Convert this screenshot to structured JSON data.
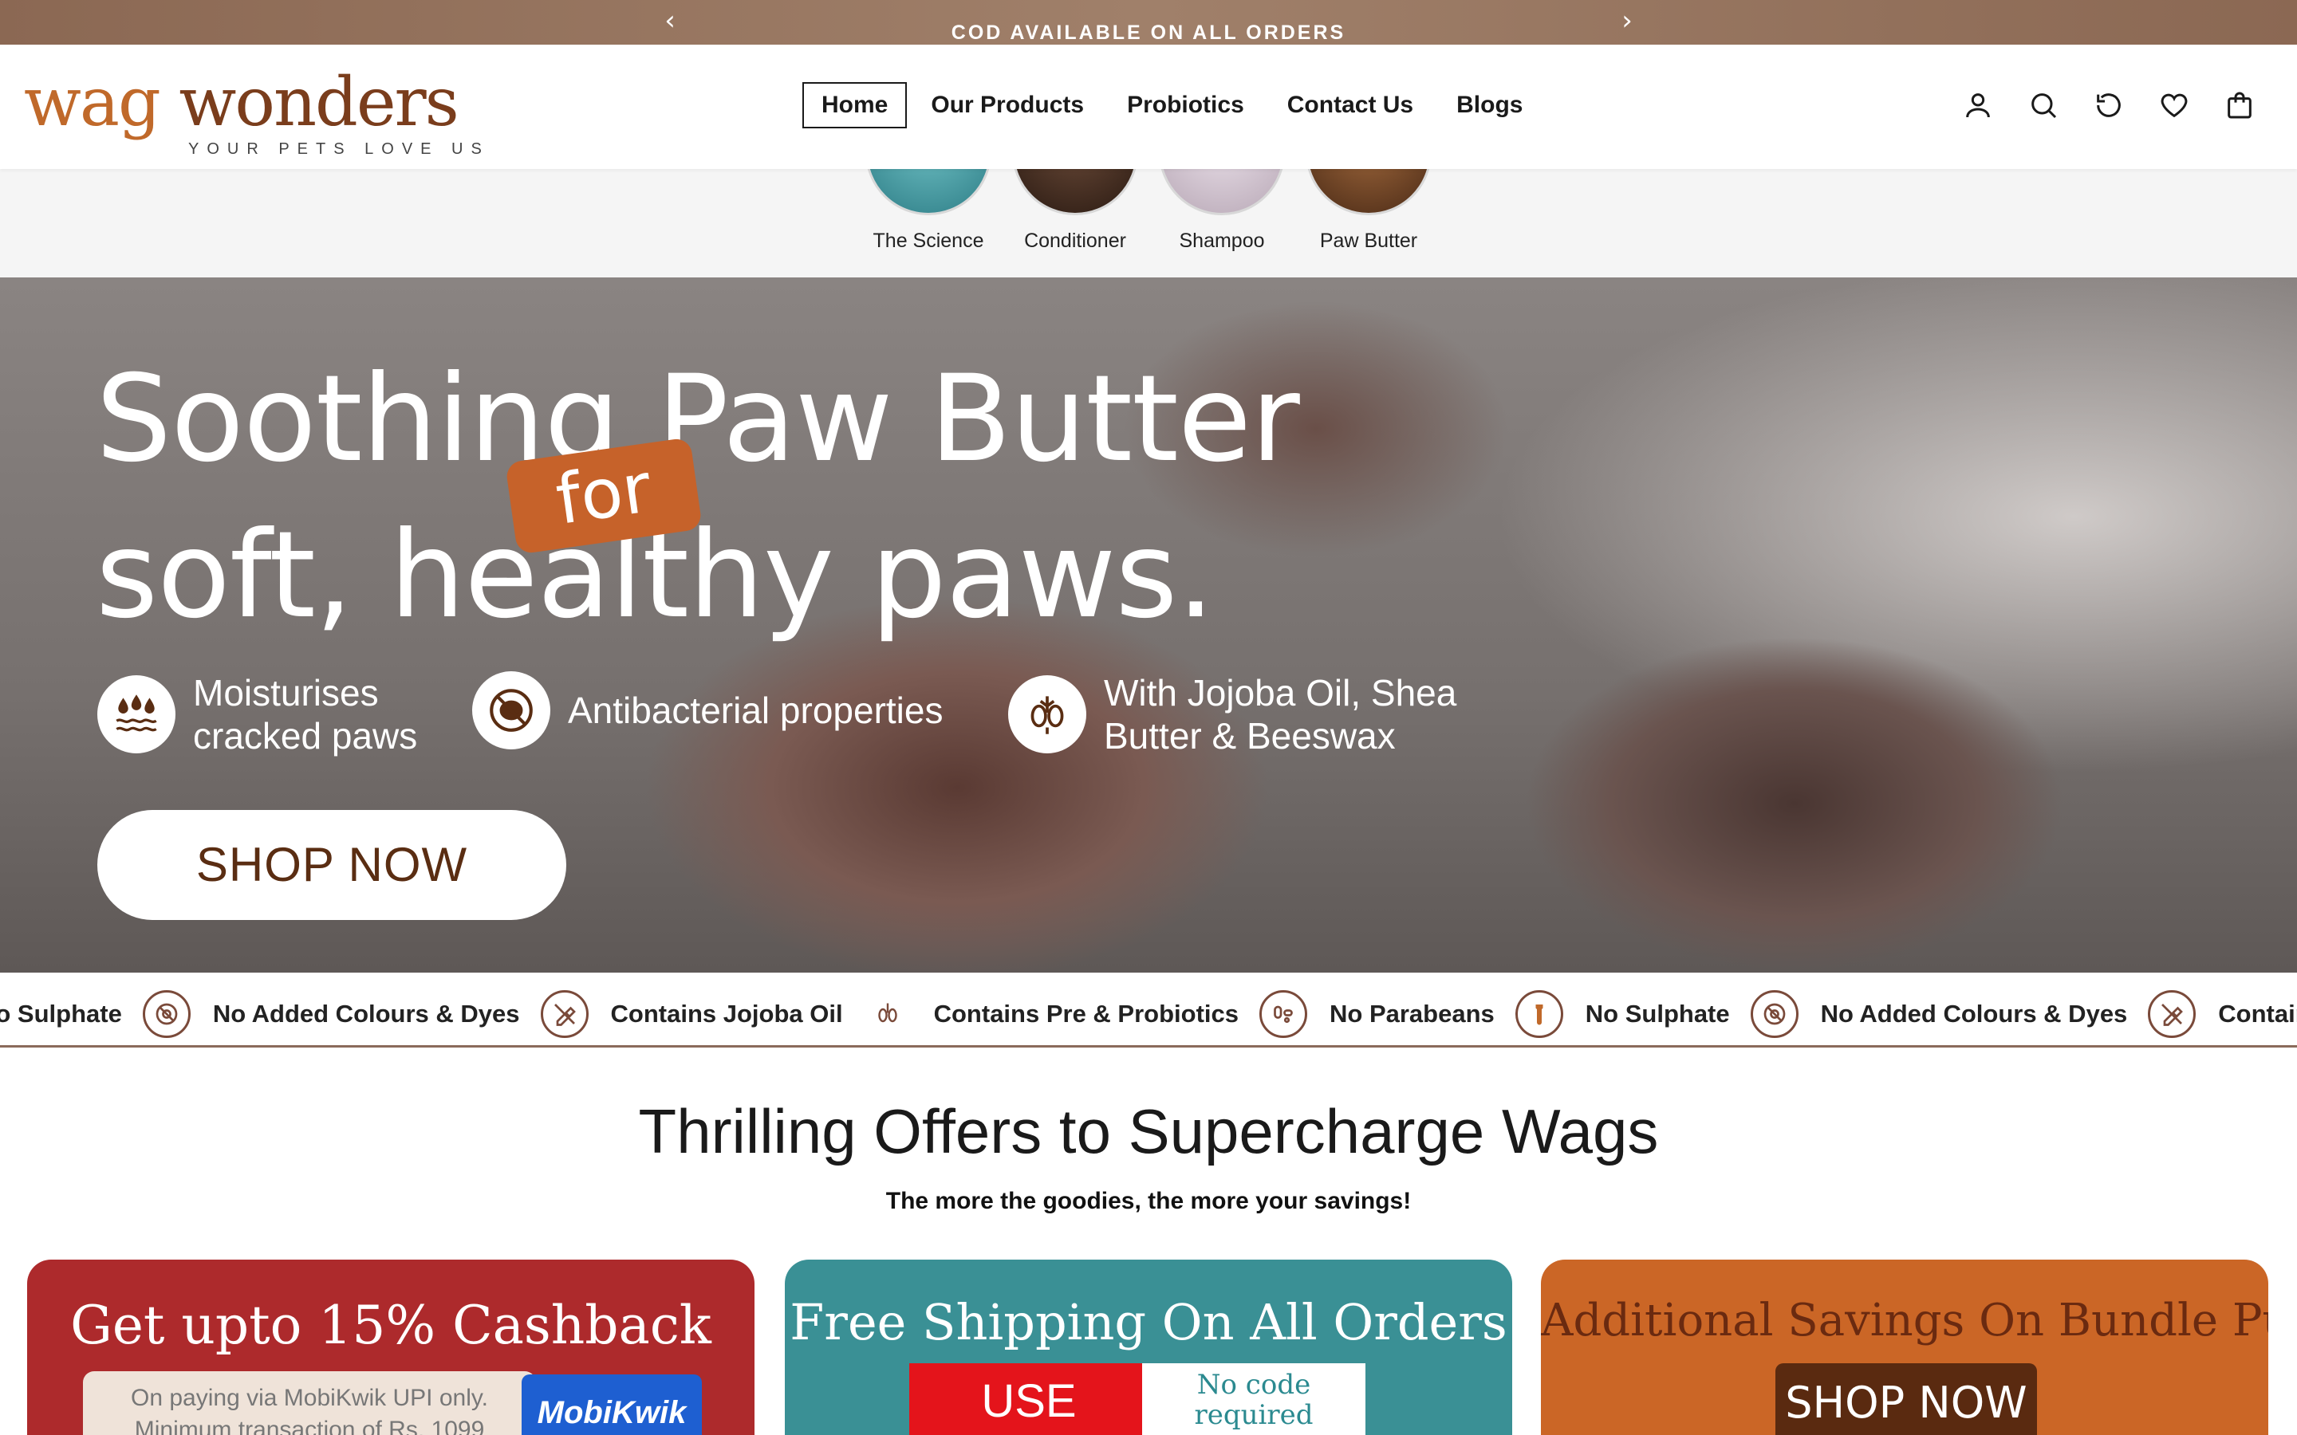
{
  "announcement": {
    "message": "COD AVAILABLE ON ALL ORDERS",
    "prev_icon": "chevron-left-icon",
    "next_icon": "chevron-right-icon"
  },
  "header": {
    "logo": {
      "word1": "wag",
      "word2": "wonders",
      "tagline": "YOUR PETS LOVE US"
    },
    "nav": [
      {
        "label": "Home",
        "active": true
      },
      {
        "label": "Our Products",
        "active": false
      },
      {
        "label": "Probiotics",
        "active": false
      },
      {
        "label": "Contact Us",
        "active": false
      },
      {
        "label": "Blogs",
        "active": false
      }
    ],
    "icons": [
      "account-icon",
      "search-icon",
      "refresh-icon",
      "wishlist-heart-icon",
      "cart-bag-icon"
    ]
  },
  "categories": [
    {
      "label": "The Science"
    },
    {
      "label": "Conditioner"
    },
    {
      "label": "Shampoo"
    },
    {
      "label": "Paw Butter"
    }
  ],
  "hero": {
    "title_line1": "Soothing Paw Butter",
    "title_line2": "soft, healthy paws.",
    "badge": "for",
    "features": [
      {
        "line1": "Moisturises",
        "line2": "cracked paws",
        "icon": "droplets-icon"
      },
      {
        "line1": "Antibacterial properties",
        "line2": "",
        "icon": "no-bacteria-icon"
      },
      {
        "line1": "With Jojoba Oil, Shea",
        "line2": "Butter & Beeswax",
        "icon": "jojoba-plant-icon"
      }
    ],
    "cta": "SHOP NOW"
  },
  "marquee": [
    {
      "label": "No Sulphate",
      "icon": "no-colours-icon"
    },
    {
      "label": "No Added Colours & Dyes",
      "icon": "no-dyes-icon"
    },
    {
      "label": "Contains Jojoba Oil",
      "icon": "jojoba-icon"
    },
    {
      "label": "Contains Pre & Probiotics",
      "icon": "probiotics-icon"
    },
    {
      "label": "No Parabeans",
      "icon": "no-parabens-icon"
    },
    {
      "label": "No Sulphate",
      "icon": "no-colours-icon"
    },
    {
      "label": "No Added Colours & Dyes",
      "icon": "no-dyes-icon"
    },
    {
      "label": "Contains Jojoba Oil",
      "icon": "jojoba-icon"
    }
  ],
  "offers": {
    "title": "Thrilling Offers to Supercharge Wags",
    "subtitle": "The more the goodies, the more your savings!",
    "cards": [
      {
        "title": "Get upto 15% Cashback",
        "note_line1": "On paying via MobiKwik UPI only.",
        "note_line2": "Minimum transaction of Rs. 1099",
        "brand": "MobiKwik"
      },
      {
        "title": "Free Shipping On All Orders",
        "code_label": "USE CODE",
        "code_note_line1": "No code",
        "code_note_line2": "required"
      },
      {
        "title": "Additional Savings On Bundle Purchases",
        "cta": "SHOP NOW"
      }
    ]
  },
  "colors": {
    "brand_orange": "#c0692a",
    "brand_brown": "#7a3d1c",
    "card_red": "#ad2a2c",
    "card_teal": "#3a9095",
    "card_orange": "#cb6626"
  }
}
